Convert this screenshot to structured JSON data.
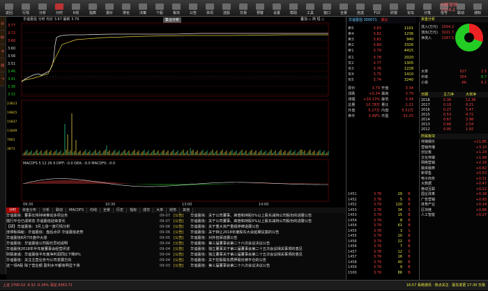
{
  "toolbar": {
    "items": [
      "返回",
      "行情",
      "分析",
      "分时",
      "K线",
      "指数",
      "报价",
      "排名",
      "决策",
      "个股",
      "板块",
      "公告",
      "资讯",
      "选股",
      "交易",
      "预警",
      "设置",
      "帮助",
      "工具",
      "窗口",
      "全景",
      "自选",
      "F10",
      "研报",
      "论坛",
      "分笔",
      "信号",
      "联动",
      "通知"
    ]
  },
  "logo": {
    "line1": "创新营销",
    "line2": "1054.2"
  },
  "main": {
    "title": "华谊嘉信 分时 均价 3.67 最新 3.79",
    "right": "叠加 ◇ 简 短 ◇",
    "tag": "集合分析"
  },
  "chart": {
    "price_ticks": [
      "3.77",
      "3.72",
      "3.66",
      "3.60",
      "3.56",
      "3.51",
      "3.46",
      "3.41",
      "3.36",
      "3.31"
    ],
    "vol_ticks": [
      "23813",
      "19825",
      "15837",
      "11849",
      "7861",
      "3873"
    ],
    "time_ticks": [
      "09:30",
      "10:30",
      "13:00",
      "14:00"
    ],
    "indicator_label": "MACDFS 5 12 26 9 DIFF: -0.0 DEA: -0.0 MACDFS: -0.0"
  },
  "bottom_tabs": [
    "分时",
    "资金分布",
    "分析",
    "联动",
    "MACDFS",
    "均线",
    "全景",
    "历史",
    "指标",
    "成交",
    "大单",
    "财务",
    "其他"
  ],
  "news": [
    {
      "a": "华谊嘉信：董事长将持续推动多项业务",
      "d": "09-07",
      "t": "[公告]",
      "b": "华谊嘉信：关于公司董事、高管和持股5%以上股东减持公司股份的进展公告"
    },
    {
      "a": "强行平仓已成常态 华谊嘉信迎来变化",
      "d": "09-07",
      "t": "[公告]",
      "b": "华谊嘉信：关于公司董事、高管和持股5%以上股东减持公司股份的进展公告"
    },
    {
      "a": "【研】华谊嘉信：3月上涨一波行情分析",
      "d": "09-06",
      "t": "[公告]",
      "b": "华谊嘉信：关于重大资产重组停牌进展公告"
    },
    {
      "a": "涨停板揭秘：华谊嘉信：盘后点评 华谊嘉信走势",
      "d": "09-06",
      "t": "[公告]",
      "b": "华谊嘉信：关于转让2018年度股东大会延期议案的公告"
    },
    {
      "a": "华谊嘉信8月7日盘中大涨",
      "d": "09-05",
      "t": "[公告]",
      "b": "华谊嘉信：对外担保进展公告"
    },
    {
      "a": "华谊嘉信：华谊嘉信公司股价异动说明",
      "d": "09-04",
      "t": "[公告]",
      "b": "华谊嘉信：第三届董事会第二十六次会议决议公告"
    },
    {
      "a": "华谊嘉信2018年半年度董事会经营评述",
      "d": "09-04",
      "t": "[公告]",
      "b": "华谊嘉信：独立董事关于第三届董事会第二十五次会议相关事项的意见"
    },
    {
      "a": "财联速递：华谊嘉信半年度净利润同比下降8%",
      "d": "09-04",
      "t": "[公告]",
      "b": "华谊嘉信：独立董事关于第三届董事会第二十五次会议相关事项的意见"
    },
    {
      "a": "华谊嘉信：关注主营业务与公司发展方向",
      "d": "09-04",
      "t": "[公告]",
      "b": "华谊嘉信：关于控股股东质押股份被平仓的公告"
    },
    {
      "a": "这一领A股 除了营业额 盈利水平都有明显下滑",
      "d": "09-03",
      "t": "[公告]",
      "b": "华谊嘉信：第三届董事会第二十六次会议决议公告"
    }
  ],
  "status": {
    "left": "上证 2700.02 -9.32 -0.34%  深证 8363.71",
    "right": "16:57 系统通讯 · 热点关注 · 股东变更 17:30 交易"
  },
  "quote": {
    "title": "华谊嘉信 300071",
    "tag": "委比",
    "asks": [
      [
        "卖5",
        "3.83",
        "1101"
      ],
      [
        "卖4",
        "3.82",
        "1236"
      ],
      [
        "卖3",
        "3.81",
        "940"
      ],
      [
        "卖2",
        "3.80",
        "3326"
      ],
      [
        "卖1",
        "3.79",
        "4415"
      ]
    ],
    "bids": [
      [
        "买1",
        "3.78",
        "2020"
      ],
      [
        "买2",
        "3.77",
        "1305"
      ],
      [
        "买3",
        "3.76",
        "1228"
      ],
      [
        "买4",
        "3.75",
        "1410"
      ],
      [
        "买5",
        "3.74",
        "3240"
      ]
    ],
    "stats": [
      [
        "现价",
        "3.79",
        "开盘",
        "3.34"
      ],
      [
        "涨跌",
        "+0.34",
        "最高",
        "3.79"
      ],
      [
        "涨幅",
        "+10.13%",
        "最低",
        "3.34"
      ],
      [
        "总量",
        "10.78万",
        "量比",
        "1.21"
      ],
      [
        "外盘",
        "5.27万",
        "内盘",
        "5.51万"
      ],
      [
        "换手",
        "3.49%",
        "市盈",
        "32.25"
      ]
    ],
    "ticks": [
      [
        "1451",
        "3.78",
        "29",
        "B"
      ],
      [
        "1452",
        "3.78",
        "5",
        "B"
      ],
      [
        "1452",
        "3.79",
        "120",
        "B"
      ],
      [
        "1453",
        "3.78",
        "34",
        "S"
      ],
      [
        "1453",
        "3.79",
        "15",
        "B"
      ],
      [
        "1454",
        "3.79",
        "8",
        "B"
      ],
      [
        "1454",
        "3.79",
        "61",
        "B"
      ],
      [
        "1455",
        "3.78",
        "3",
        "S"
      ],
      [
        "1455",
        "3.79",
        "10",
        "B"
      ],
      [
        "1456",
        "3.79",
        "22",
        "B"
      ],
      [
        "1456",
        "3.79",
        "7",
        "B"
      ],
      [
        "1457",
        "3.78",
        "12",
        "S"
      ],
      [
        "1457",
        "3.79",
        "16",
        "B"
      ],
      [
        "1458",
        "3.79",
        "40",
        "B"
      ],
      [
        "1459",
        "3.79",
        "9",
        "B"
      ],
      [
        "1500",
        "3.79",
        "86",
        "B"
      ]
    ]
  },
  "fund": {
    "header": "资金分析",
    "items": [
      [
        "流入(万元)",
        "1054.2"
      ],
      [
        "流出(万元)",
        "3221.7"
      ],
      [
        "净流入",
        "1167.5"
      ]
    ],
    "big": [
      [
        "大单",
        "527",
        "+",
        "2.5"
      ],
      [
        "中单",
        "354",
        "-",
        "8.7"
      ],
      [
        "小单",
        "-66",
        "+",
        "6.1"
      ]
    ],
    "table_head": [
      "日期",
      "主力净",
      "大单净"
    ],
    "table": [
      [
        "2018",
        "0.30",
        "12.38"
      ],
      [
        "2017",
        "0.18",
        "8.21"
      ],
      [
        "2016",
        "0.27",
        "5.47"
      ],
      [
        "2015",
        "0.53",
        "4.72"
      ],
      [
        "2014",
        "0.67",
        "3.98"
      ],
      [
        "2013",
        "0.86",
        "2.54"
      ],
      [
        "2012",
        "0.95",
        "1.92"
      ]
    ],
    "sector_head": "所属板块",
    "sectors": [
      [
        "传媒娱乐",
        "+11.85"
      ],
      [
        "营销传播",
        "+3.10"
      ],
      [
        "创业板",
        "+1.24"
      ],
      [
        "文化传媒",
        "+1.98"
      ],
      [
        "网络营销",
        "+2.16"
      ],
      [
        "融资融券",
        "+0.82"
      ],
      [
        "新零售",
        "+0.53"
      ],
      [
        "电子商务",
        "+0.31"
      ],
      [
        "大数据",
        "+0.47"
      ],
      [
        "移动互联",
        "+0.22"
      ],
      [
        "国企改革",
        "+0.18"
      ],
      [
        "广告营销",
        "+0.93"
      ],
      [
        "体育产业",
        "+0.14"
      ],
      [
        "区块链",
        "+0.66"
      ],
      [
        "人工智能",
        "+0.27"
      ]
    ]
  }
}
